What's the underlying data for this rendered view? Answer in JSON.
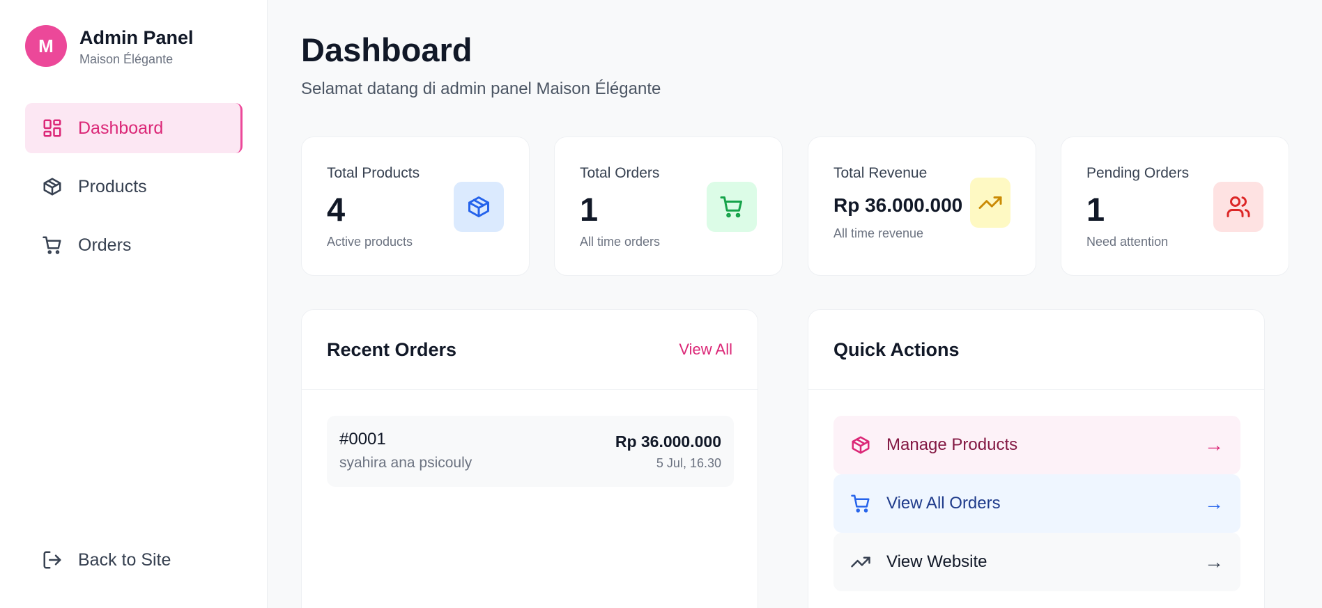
{
  "sidebar": {
    "avatar_letter": "M",
    "title": "Admin Panel",
    "subtitle": "Maison Élégante",
    "nav": [
      {
        "label": "Dashboard",
        "icon": "dashboard-icon",
        "active": true
      },
      {
        "label": "Products",
        "icon": "package-icon",
        "active": false
      },
      {
        "label": "Orders",
        "icon": "cart-icon",
        "active": false
      }
    ],
    "back_label": "Back to Site"
  },
  "header": {
    "title": "Dashboard",
    "subtitle": "Selamat datang di admin panel Maison Élégante"
  },
  "stats": [
    {
      "label": "Total Products",
      "value": "4",
      "note": "Active products",
      "icon": "package-icon",
      "icon_bg": "#dbeafe",
      "icon_color": "#2563eb"
    },
    {
      "label": "Total Orders",
      "value": "1",
      "note": "All time orders",
      "icon": "cart-icon",
      "icon_bg": "#dcfce7",
      "icon_color": "#16a34a"
    },
    {
      "label": "Total Revenue",
      "value": "Rp 36.000.000",
      "note": "All time revenue",
      "icon": "trending-up-icon",
      "icon_bg": "#fef9c3",
      "icon_color": "#ca8a04"
    },
    {
      "label": "Pending Orders",
      "value": "1",
      "note": "Need attention",
      "icon": "users-icon",
      "icon_bg": "#fee2e2",
      "icon_color": "#dc2626"
    }
  ],
  "recent_orders": {
    "title": "Recent Orders",
    "view_all": "View All",
    "orders": [
      {
        "id": "#0001",
        "customer": "syahira ana psicouly",
        "amount": "Rp 36.000.000",
        "date": "5 Jul, 16.30"
      }
    ]
  },
  "quick_actions": {
    "title": "Quick Actions",
    "items": [
      {
        "label": "Manage Products",
        "icon": "package-icon",
        "arrow": "→",
        "bg": "#fdf2f8",
        "color": "#831843",
        "icon_color": "#db2777"
      },
      {
        "label": "View All Orders",
        "icon": "cart-icon",
        "arrow": "→",
        "bg": "#eff6ff",
        "color": "#1e3a8a",
        "icon_color": "#2563eb"
      },
      {
        "label": "View Website",
        "icon": "trending-up-icon",
        "arrow": "→",
        "bg": "#f8f9fa",
        "color": "#111827",
        "icon_color": "#374151"
      }
    ]
  },
  "colors": {
    "accent": "#ec4899",
    "accent_dark": "#db2777"
  }
}
